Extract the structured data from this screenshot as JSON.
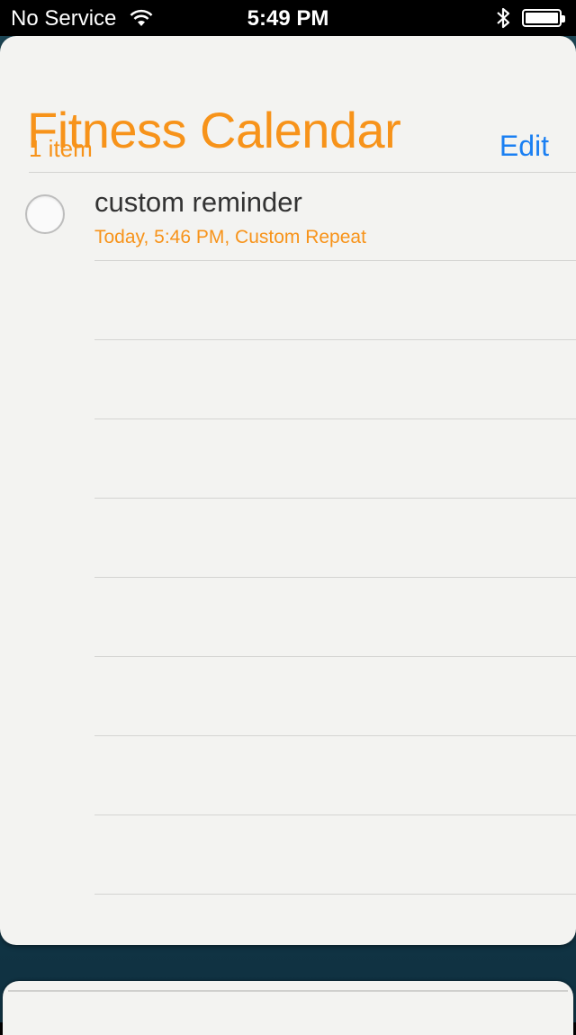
{
  "status_bar": {
    "carrier": "No Service",
    "time": "5:49 PM",
    "wifi_icon": "wifi-icon",
    "bluetooth_icon": "bluetooth-icon",
    "battery_icon": "battery-icon",
    "battery_level": 1.0
  },
  "list": {
    "title": "Fitness Calendar",
    "count": "1 item",
    "edit_label": "Edit",
    "accent_color": "#f7931a",
    "link_color": "#1a7ff2",
    "reminders": [
      {
        "title": "custom reminder",
        "subtitle": "Today, 5:46 PM, Custom Repeat",
        "completed": false
      }
    ]
  }
}
